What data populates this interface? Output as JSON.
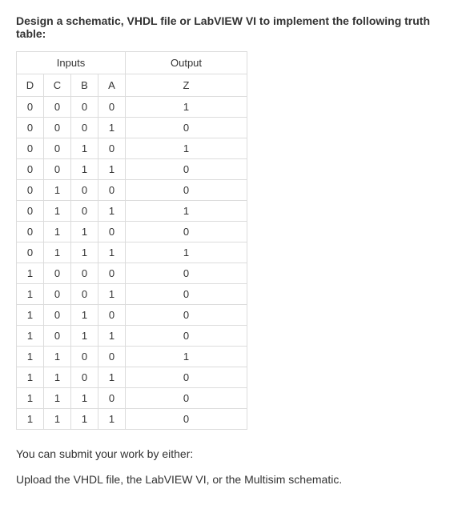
{
  "heading": "Design a schematic, VHDL file or LabVIEW VI to implement the following truth table:",
  "table": {
    "group_headers": {
      "inputs": "Inputs",
      "output": "Output"
    },
    "col_headers": {
      "d": "D",
      "c": "C",
      "b": "B",
      "a": "A",
      "z": "Z"
    },
    "rows": [
      {
        "d": "0",
        "c": "0",
        "b": "0",
        "a": "0",
        "z": "1"
      },
      {
        "d": "0",
        "c": "0",
        "b": "0",
        "a": "1",
        "z": "0"
      },
      {
        "d": "0",
        "c": "0",
        "b": "1",
        "a": "0",
        "z": "1"
      },
      {
        "d": "0",
        "c": "0",
        "b": "1",
        "a": "1",
        "z": "0"
      },
      {
        "d": "0",
        "c": "1",
        "b": "0",
        "a": "0",
        "z": "0"
      },
      {
        "d": "0",
        "c": "1",
        "b": "0",
        "a": "1",
        "z": "1"
      },
      {
        "d": "0",
        "c": "1",
        "b": "1",
        "a": "0",
        "z": "0"
      },
      {
        "d": "0",
        "c": "1",
        "b": "1",
        "a": "1",
        "z": "1"
      },
      {
        "d": "1",
        "c": "0",
        "b": "0",
        "a": "0",
        "z": "0"
      },
      {
        "d": "1",
        "c": "0",
        "b": "0",
        "a": "1",
        "z": "0"
      },
      {
        "d": "1",
        "c": "0",
        "b": "1",
        "a": "0",
        "z": "0"
      },
      {
        "d": "1",
        "c": "0",
        "b": "1",
        "a": "1",
        "z": "0"
      },
      {
        "d": "1",
        "c": "1",
        "b": "0",
        "a": "0",
        "z": "1"
      },
      {
        "d": "1",
        "c": "1",
        "b": "0",
        "a": "1",
        "z": "0"
      },
      {
        "d": "1",
        "c": "1",
        "b": "1",
        "a": "0",
        "z": "0"
      },
      {
        "d": "1",
        "c": "1",
        "b": "1",
        "a": "1",
        "z": "0"
      }
    ]
  },
  "para1": "You can submit your work by either:",
  "para2": "Upload the VHDL file, the LabVIEW VI, or the Multisim schematic."
}
